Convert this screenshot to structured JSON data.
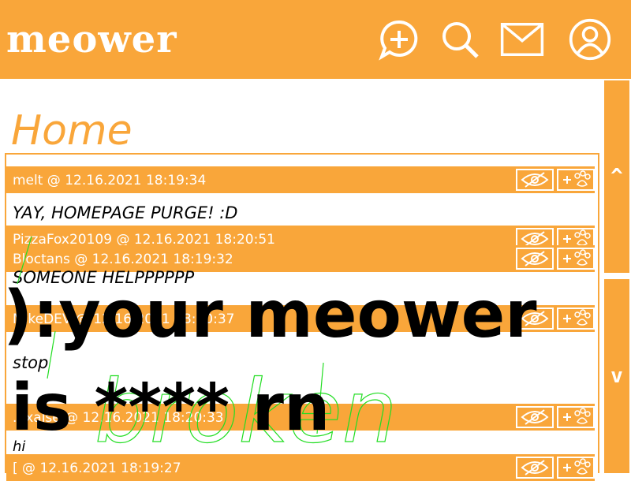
{
  "app": {
    "logo": "meower"
  },
  "header": {
    "icons": [
      "new-post-icon",
      "search-icon",
      "mail-icon",
      "profile-icon"
    ]
  },
  "page": {
    "title": "Home"
  },
  "scroll": {
    "up_label": "^",
    "down_label": "v"
  },
  "posts": [
    {
      "author": "melt @ 12.16.2021 18:19:34",
      "body": "YAY, HOMEPAGE PURGE! :D"
    },
    {
      "author": "PizzaFox20109 @ 12.16.2021 18:20:51",
      "body": "SOMEONE HELPPPPPP"
    },
    {
      "author": "Bloctans @ 12.16.2021 18:19:32",
      "body": ""
    },
    {
      "author": "MikeDEV @ 12.16.2021 18:20:37",
      "body": "stop"
    },
    {
      "author": "...xalse @ 12.16.2021 18:20:33",
      "body": "hi"
    },
    {
      "author": "[ @ 12.16.2021 18:19:27",
      "body": ""
    }
  ],
  "overlay": {
    "line1": "):your meower",
    "line2": "is **** rn",
    "scribble_text": "broken"
  },
  "colors": {
    "accent": "#f9a63a",
    "background": "#ffffff",
    "scribble": "#22dd22"
  }
}
